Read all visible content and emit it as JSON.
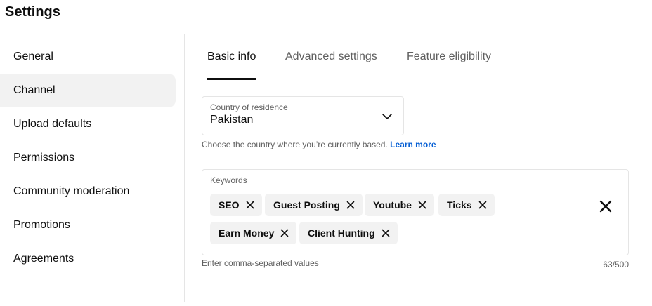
{
  "header": {
    "title": "Settings"
  },
  "sidebar": {
    "items": [
      {
        "label": "General"
      },
      {
        "label": "Channel",
        "active": true
      },
      {
        "label": "Upload defaults"
      },
      {
        "label": "Permissions"
      },
      {
        "label": "Community moderation"
      },
      {
        "label": "Promotions"
      },
      {
        "label": "Agreements"
      }
    ]
  },
  "tabs": [
    {
      "label": "Basic info",
      "active": true
    },
    {
      "label": "Advanced settings"
    },
    {
      "label": "Feature eligibility"
    }
  ],
  "country": {
    "label": "Country of residence",
    "value": "Pakistan",
    "helper": "Choose the country where you’re currently based.",
    "learn_more": "Learn more",
    "icon": "chevron-down-icon"
  },
  "keywords": {
    "label": "Keywords",
    "chips": [
      "SEO",
      "Guest Posting",
      "Youtube",
      "Ticks",
      "Earn Money",
      "Client Hunting"
    ],
    "helper": "Enter comma-separated values",
    "count": "63/500",
    "clear_icon": "close-icon"
  },
  "colors": {
    "accent_link": "#065fd4",
    "active_bg": "#f2f2f2",
    "border": "#e5e5e5",
    "secondary_text": "#606060"
  }
}
